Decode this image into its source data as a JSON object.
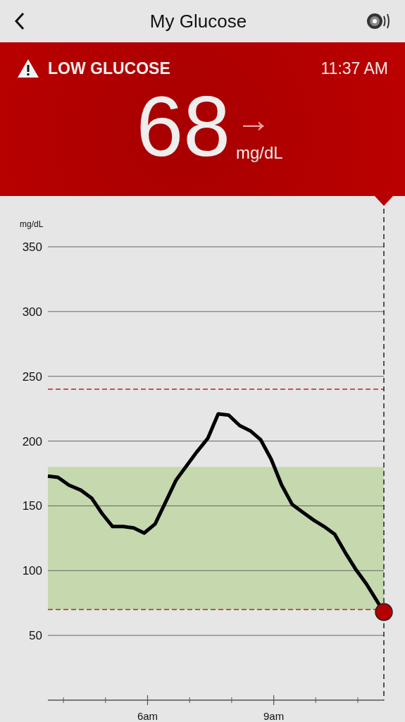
{
  "header": {
    "title": "My Glucose"
  },
  "alert": {
    "title": "LOW GLUCOSE",
    "time": "11:37 AM",
    "value": "68",
    "trend_arrow": "→",
    "unit": "mg/dL"
  },
  "chart": {
    "chart_data": {
      "type": "line",
      "ylabel": "mg/dL",
      "grid": true,
      "xlim": [
        3.63,
        11.62
      ],
      "ylim": [
        0,
        350
      ],
      "yticks": [
        50,
        100,
        150,
        200,
        250,
        300,
        350
      ],
      "xticks": [
        {
          "value": 6,
          "label": "6am"
        },
        {
          "value": 9,
          "label": "9am"
        }
      ],
      "x": [
        3.63,
        3.87,
        4.13,
        4.42,
        4.67,
        4.92,
        5.17,
        5.42,
        5.67,
        5.92,
        6.18,
        6.43,
        6.68,
        6.93,
        7.18,
        7.43,
        7.68,
        7.93,
        8.19,
        8.44,
        8.69,
        8.94,
        9.19,
        9.44,
        9.69,
        9.95,
        10.2,
        10.45,
        10.7,
        10.95,
        11.2,
        11.62
      ],
      "series": [
        {
          "color": "#000000",
          "values": [
            173,
            172,
            166,
            162,
            156,
            144,
            134,
            134,
            133,
            129,
            136,
            153,
            170,
            181,
            192,
            202,
            221,
            220,
            212,
            208,
            201,
            186,
            166,
            151,
            145,
            139,
            134,
            128,
            114,
            101,
            90,
            68
          ]
        }
      ],
      "bands": [
        {
          "axis": "y",
          "from": 70,
          "to": 180,
          "color": "#c5d8ae"
        }
      ],
      "ref_lines": [
        {
          "axis": "y",
          "value": 240,
          "color": "#c0201f"
        },
        {
          "axis": "y",
          "value": 70,
          "color": "#c0201f"
        }
      ]
    }
  }
}
